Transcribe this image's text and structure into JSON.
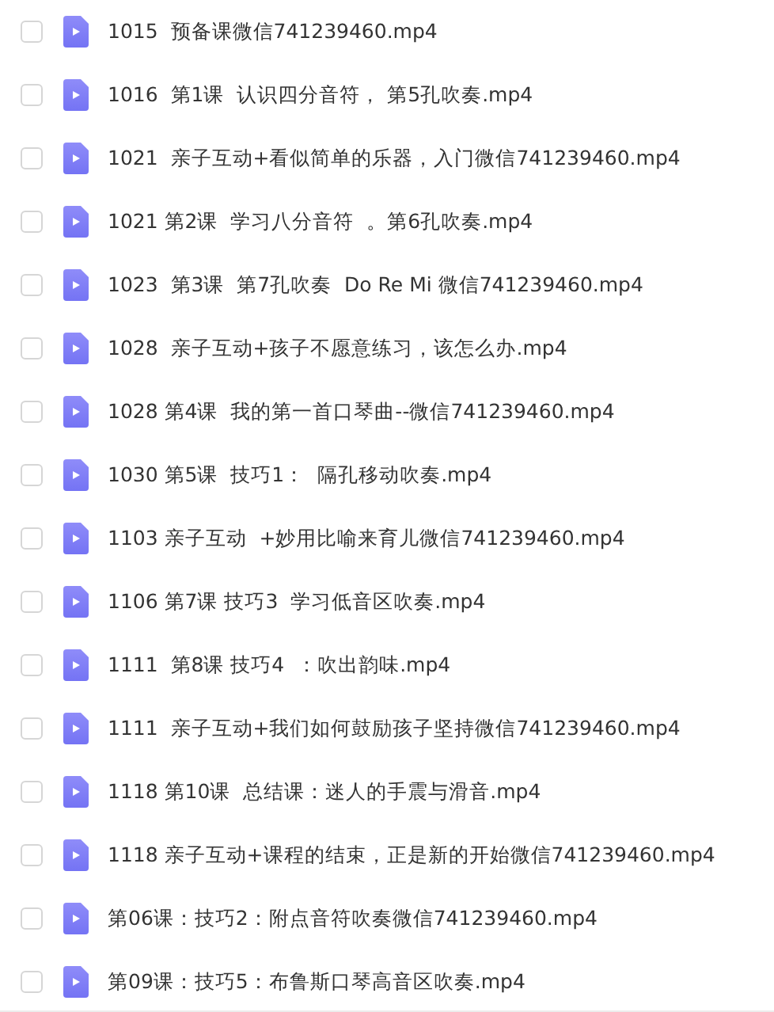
{
  "files": [
    {
      "name": "1015  预备课微信741239460.mp4",
      "checked": false
    },
    {
      "name": "1016  第1课  认识四分音符， 第5孔吹奏.mp4",
      "checked": false
    },
    {
      "name": "1021  亲子互动+看似简单的乐器，入门微信741239460.mp4",
      "checked": false
    },
    {
      "name": "1021 第2课  学习八分音符  。第6孔吹奏.mp4",
      "checked": false
    },
    {
      "name": "1023  第3课  第7孔吹奏  Do Re Mi 微信741239460.mp4",
      "checked": false
    },
    {
      "name": "1028  亲子互动+孩子不愿意练习，该怎么办.mp4",
      "checked": false
    },
    {
      "name": "1028 第4课  我的第一首口琴曲--微信741239460.mp4",
      "checked": false
    },
    {
      "name": "1030 第5课  技巧1：  隔孔移动吹奏.mp4",
      "checked": false
    },
    {
      "name": "1103 亲子互动  +妙用比喻来育儿微信741239460.mp4",
      "checked": false
    },
    {
      "name": "1106 第7课 技巧3  学习低音区吹奏.mp4",
      "checked": false
    },
    {
      "name": "1111  第8课 技巧4  ：吹出韵味.mp4",
      "checked": false
    },
    {
      "name": "1111  亲子互动+我们如何鼓励孩子坚持微信741239460.mp4",
      "checked": false
    },
    {
      "name": "1118 第10课  总结课：迷人的手震与滑音.mp4",
      "checked": false
    },
    {
      "name": "1118 亲子互动+课程的结束，正是新的开始微信741239460.mp4",
      "checked": false
    },
    {
      "name": "第06课：技巧2：附点音符吹奏微信741239460.mp4",
      "checked": false
    },
    {
      "name": "第09课：技巧5：布鲁斯口琴高音区吹奏.mp4",
      "checked": false
    }
  ]
}
